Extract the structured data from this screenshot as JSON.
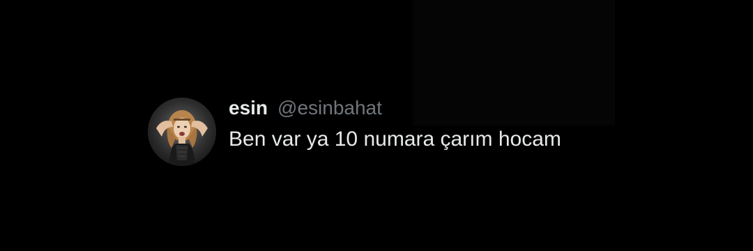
{
  "tweet": {
    "display_name": "esin",
    "handle": "@esinbahat",
    "text": "Ben var ya 10 numara çarım hocam",
    "avatar_icon": "profile-photo"
  },
  "colors": {
    "background": "#000000",
    "primary_text": "#e7e9ea",
    "secondary_text": "#71767b"
  }
}
